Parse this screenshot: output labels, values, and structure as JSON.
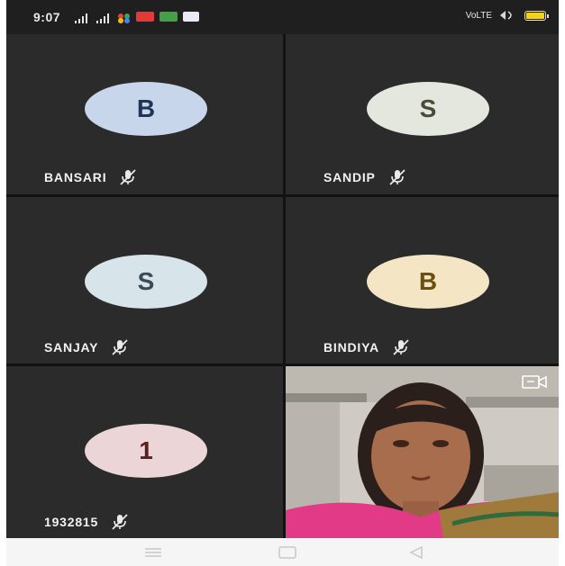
{
  "status_bar": {
    "time": "9:07",
    "right_text": "VoLTE",
    "battery_color": "#f2d21c"
  },
  "participants": [
    {
      "name": "BANSARI",
      "initial": "B",
      "avatar_bg": "#c7d6ea",
      "avatar_fg": "#1f3556",
      "mic": "mic-off-icon"
    },
    {
      "name": "SANDIP",
      "initial": "S",
      "avatar_bg": "#e4e7dd",
      "avatar_fg": "#4a4a3a",
      "mic": "mic-off-icon"
    },
    {
      "name": "SANJAY",
      "initial": "S",
      "avatar_bg": "#d7e4ea",
      "avatar_fg": "#3b4b55",
      "mic": "mic-off-icon"
    },
    {
      "name": "BINDIYA",
      "initial": "B",
      "avatar_bg": "#f4e6c4",
      "avatar_fg": "#6a4f10",
      "mic": "mic-off-icon"
    },
    {
      "name": "1932815",
      "initial": "1",
      "avatar_bg": "#ecd5d6",
      "avatar_fg": "#5a1f22",
      "mic": "mic-off-icon"
    }
  ],
  "self_view": {
    "icon": "switch-camera-icon"
  },
  "nav_bar": {
    "icons": [
      "menu-icon",
      "home-icon",
      "back-icon"
    ]
  }
}
